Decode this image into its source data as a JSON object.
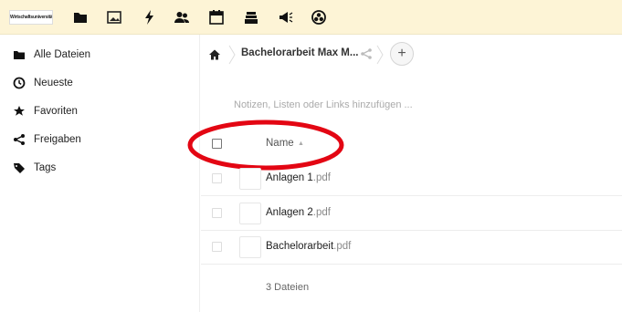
{
  "topbar": {
    "logo_text": "Wirtschaftsuniversität",
    "apps": [
      {
        "name": "folder-icon"
      },
      {
        "name": "image-icon"
      },
      {
        "name": "activity-icon"
      },
      {
        "name": "contacts-icon"
      },
      {
        "name": "calendar-icon"
      },
      {
        "name": "deck-icon"
      },
      {
        "name": "announcement-icon"
      },
      {
        "name": "circles-icon"
      }
    ],
    "colors": {
      "background": "#fdf4d6"
    }
  },
  "sidebar": {
    "items": [
      {
        "label": "Alle Dateien",
        "icon": "folder-icon"
      },
      {
        "label": "Neueste",
        "icon": "clock-icon"
      },
      {
        "label": "Favoriten",
        "icon": "star-icon"
      },
      {
        "label": "Freigaben",
        "icon": "share-icon"
      },
      {
        "label": "Tags",
        "icon": "tag-icon"
      }
    ]
  },
  "breadcrumb": {
    "home_icon": "home-icon",
    "current": "Bachelorarbeit Max M...",
    "add_label": "+"
  },
  "notes": {
    "placeholder": "Notizen, Listen oder Links hinzufügen ..."
  },
  "table": {
    "name_header": "Name",
    "sort_indicator": "▲",
    "files": [
      {
        "base": "Anlagen 1",
        "ext": ".pdf"
      },
      {
        "base": "Anlagen 2",
        "ext": ".pdf"
      },
      {
        "base": "Bachelorarbeit",
        "ext": ".pdf"
      }
    ],
    "footer": "3 Dateien"
  },
  "annotation": {
    "color": "#e30613"
  }
}
